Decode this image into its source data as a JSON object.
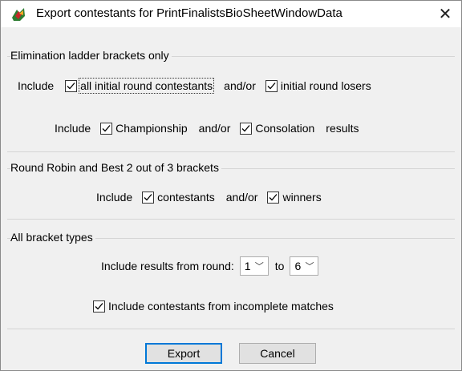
{
  "window": {
    "title": "Export contestants for PrintFinalistsBioSheetWindowData",
    "close_glyph": "✕"
  },
  "elimination": {
    "group_title": "Elimination ladder brackets only",
    "row1": {
      "include": "Include",
      "all_initial": "all initial round contestants",
      "andor": "and/or",
      "initial_losers": "initial round losers"
    },
    "row2": {
      "include": "Include",
      "championship": "Championship",
      "andor": "and/or",
      "consolation": "Consolation",
      "results": "results"
    }
  },
  "round_robin": {
    "group_title": "Round Robin and Best 2 out of 3 brackets",
    "include": "Include",
    "contestants": "contestants",
    "andor": "and/or",
    "winners": "winners"
  },
  "all_types": {
    "group_title": "All bracket types",
    "results_label": "Include results from round:",
    "from_round": "1",
    "to_label": "to",
    "to_round": "6",
    "incomplete": "Include contestants from incomplete matches"
  },
  "buttons": {
    "export": "Export",
    "cancel": "Cancel"
  },
  "checkboxes_checked": true
}
